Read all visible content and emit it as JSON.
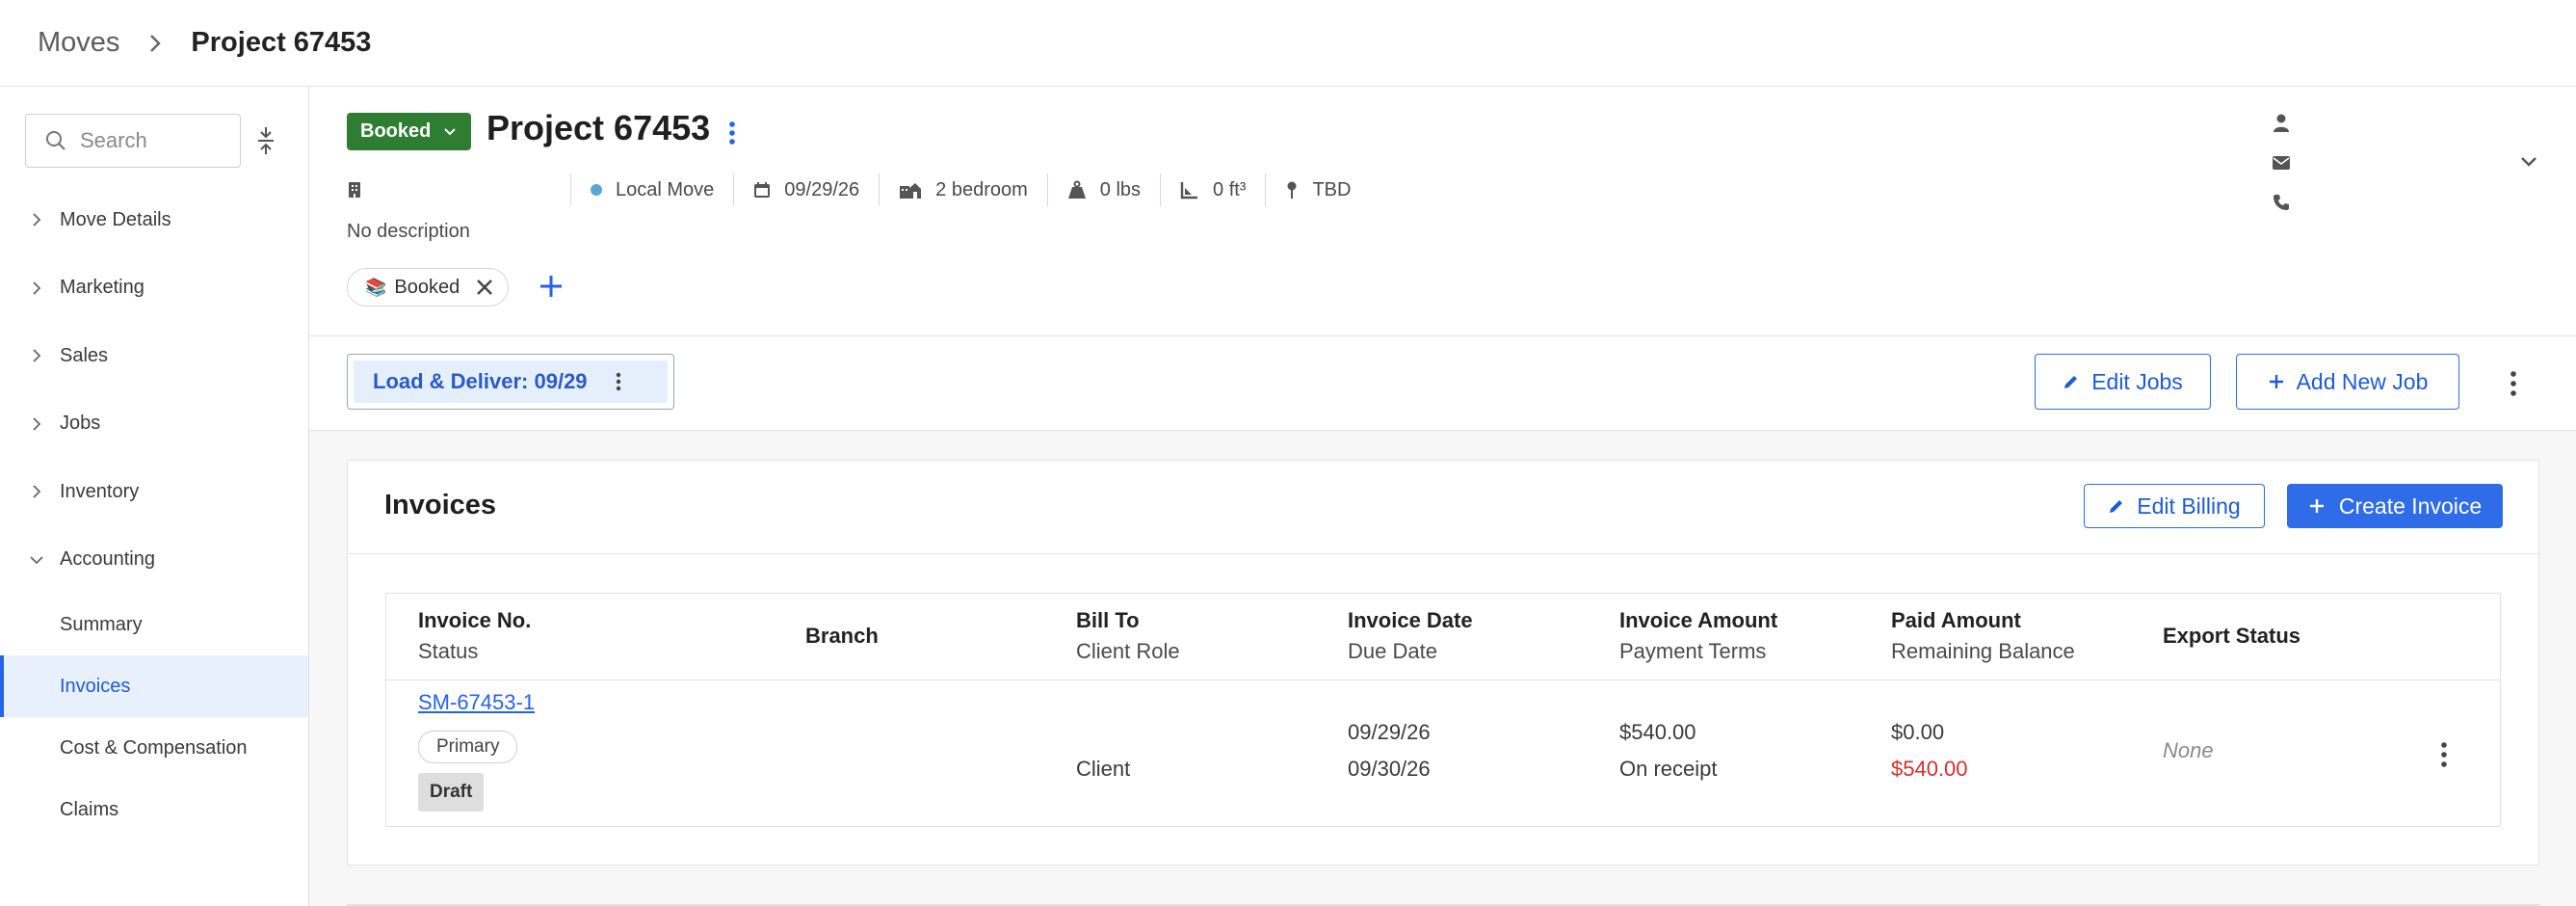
{
  "breadcrumb": {
    "parent": "Moves",
    "current": "Project 67453"
  },
  "sidebar": {
    "search_placeholder": "Search",
    "sections": [
      {
        "label": "Move Details",
        "expanded": false
      },
      {
        "label": "Marketing",
        "expanded": false
      },
      {
        "label": "Sales",
        "expanded": false
      },
      {
        "label": "Jobs",
        "expanded": false
      },
      {
        "label": "Inventory",
        "expanded": false
      },
      {
        "label": "Accounting",
        "expanded": true
      }
    ],
    "accounting_items": [
      {
        "label": "Summary",
        "active": false
      },
      {
        "label": "Invoices",
        "active": true
      },
      {
        "label": "Cost & Compensation",
        "active": false
      },
      {
        "label": "Claims",
        "active": false
      }
    ]
  },
  "project": {
    "status": "Booked",
    "title": "Project 67453",
    "move_type": "Local Move",
    "date": "09/29/26",
    "size": "2 bedroom",
    "weight": "0 lbs",
    "volume": "0 ft³",
    "location": "TBD",
    "description": "No description",
    "tag": {
      "emoji": "📚",
      "label": "Booked"
    }
  },
  "jobs": {
    "job_label": "Load & Deliver: 09/29",
    "edit_jobs": "Edit Jobs",
    "add_job": "Add New Job"
  },
  "invoices": {
    "title": "Invoices",
    "edit_billing": "Edit Billing",
    "create_invoice": "Create Invoice",
    "headers": {
      "invoice_no": "Invoice No.",
      "status": "Status",
      "branch": "Branch",
      "bill_to": "Bill To",
      "client_role": "Client Role",
      "invoice_date": "Invoice Date",
      "due_date": "Due Date",
      "invoice_amount": "Invoice Amount",
      "payment_terms": "Payment Terms",
      "paid_amount": "Paid Amount",
      "remaining_balance": "Remaining Balance",
      "export_status": "Export Status"
    },
    "rows": [
      {
        "invoice_no": "SM-67453-1",
        "role_badge": "Primary",
        "status": "Draft",
        "client_role": "Client",
        "invoice_date": "09/29/26",
        "due_date": "09/30/26",
        "invoice_amount": "$540.00",
        "payment_terms": "On receipt",
        "paid_amount": "$0.00",
        "remaining_balance": "$540.00",
        "export_status": "None"
      }
    ]
  },
  "colors": {
    "accent": "#2563eb",
    "booked_green": "#2e7d32",
    "balance_red": "#d32f2f"
  }
}
